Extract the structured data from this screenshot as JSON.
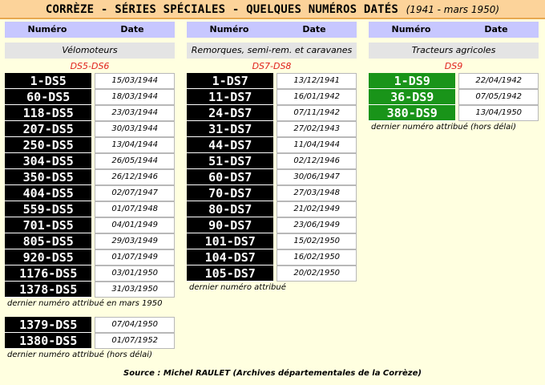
{
  "title": {
    "main": "CORRÈZE - SÉRIES SPÉCIALES - QUELQUES NUMÉROS DATÉS",
    "sub": "(1941 - mars 1950)"
  },
  "headers": {
    "numero": "Numéro",
    "date": "Date"
  },
  "col1": {
    "category": "Vélomoteurs",
    "series": "DS5-DS6",
    "rows": [
      {
        "plate": "1-DS5",
        "date": "15/03/1944"
      },
      {
        "plate": "60-DS5",
        "date": "18/03/1944"
      },
      {
        "plate": "118-DS5",
        "date": "23/03/1944"
      },
      {
        "plate": "207-DS5",
        "date": "30/03/1944"
      },
      {
        "plate": "250-DS5",
        "date": "13/04/1944"
      },
      {
        "plate": "304-DS5",
        "date": "26/05/1944"
      },
      {
        "plate": "350-DS5",
        "date": "26/12/1946"
      },
      {
        "plate": "404-DS5",
        "date": "02/07/1947"
      },
      {
        "plate": "559-DS5",
        "date": "01/07/1948"
      },
      {
        "plate": "701-DS5",
        "date": "04/01/1949"
      },
      {
        "plate": "805-DS5",
        "date": "29/03/1949"
      },
      {
        "plate": "920-DS5",
        "date": "01/07/1949"
      },
      {
        "plate": "1176-DS5",
        "date": "03/01/1950"
      },
      {
        "plate": "1378-DS5",
        "date": "31/03/1950"
      }
    ],
    "note1": "dernier numéro attribué en mars 1950",
    "rows2": [
      {
        "plate": "1379-DS5",
        "date": "07/04/1950"
      },
      {
        "plate": "1380-DS5",
        "date": "01/07/1952"
      }
    ],
    "note2": "dernier numéro attribué (hors délai)"
  },
  "col2": {
    "category": "Remorques, semi-rem. et caravanes",
    "series": "DS7-DS8",
    "rows": [
      {
        "plate": "1-DS7",
        "date": "13/12/1941"
      },
      {
        "plate": "11-DS7",
        "date": "16/01/1942"
      },
      {
        "plate": "24-DS7",
        "date": "07/11/1942"
      },
      {
        "plate": "31-DS7",
        "date": "27/02/1943"
      },
      {
        "plate": "44-DS7",
        "date": "11/04/1944"
      },
      {
        "plate": "51-DS7",
        "date": "02/12/1946"
      },
      {
        "plate": "60-DS7",
        "date": "30/06/1947"
      },
      {
        "plate": "70-DS7",
        "date": "27/03/1948"
      },
      {
        "plate": "80-DS7",
        "date": "21/02/1949"
      },
      {
        "plate": "90-DS7",
        "date": "23/06/1949"
      },
      {
        "plate": "101-DS7",
        "date": "15/02/1950"
      },
      {
        "plate": "104-DS7",
        "date": "16/02/1950"
      },
      {
        "plate": "105-DS7",
        "date": "20/02/1950"
      }
    ],
    "note1": "dernier numéro attribué"
  },
  "col3": {
    "category": "Tracteurs agricoles",
    "series": "DS9",
    "rows": [
      {
        "plate": "1-DS9",
        "date": "22/04/1942"
      },
      {
        "plate": "36-DS9",
        "date": "07/05/1942"
      },
      {
        "plate": "380-DS9",
        "date": "13/04/1950"
      }
    ],
    "note1": "dernier numéro attribué (hors délai)"
  },
  "source": "Source : Michel RAULET (Archives départementales de la Corrèze)"
}
